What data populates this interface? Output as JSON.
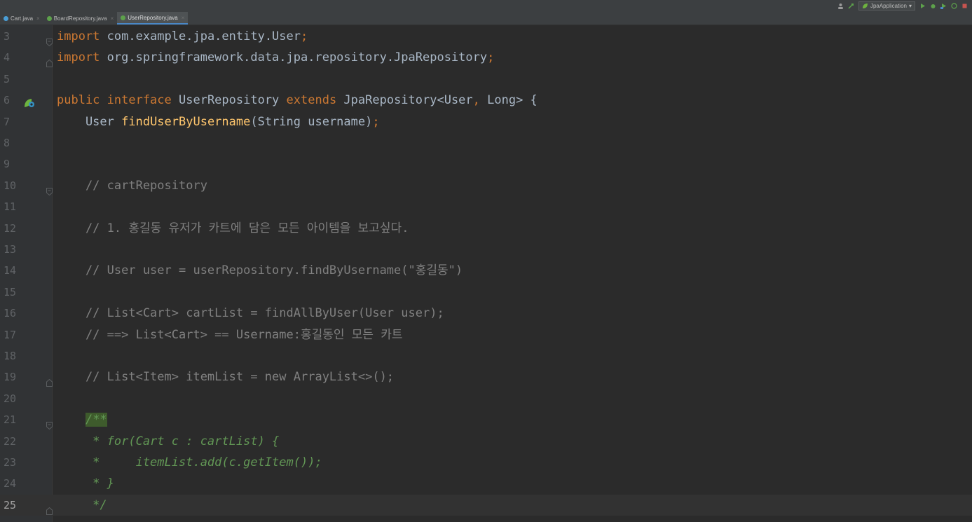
{
  "tabs": [
    {
      "label": "Cart.java",
      "icon_color": "#4a9ed6",
      "active": false
    },
    {
      "label": "BoardRepository.java",
      "icon_color": "#5da14b",
      "active": false
    },
    {
      "label": "UserRepository.java",
      "icon_color": "#5da14b",
      "active": true
    }
  ],
  "run_config": {
    "label": "JpaApplication"
  },
  "colors": {
    "keyword": "#cc7832",
    "method": "#ffc66d",
    "comment": "#808080",
    "doc_comment": "#629755",
    "text": "#a9b7c6",
    "background": "#2b2b2b"
  },
  "lines": [
    {
      "num": "3",
      "segments": [
        {
          "cls": "kw",
          "text": "import"
        },
        {
          "cls": "plain",
          "text": " com.example.jpa.entity.User"
        },
        {
          "cls": "kw",
          "text": ";"
        }
      ]
    },
    {
      "num": "4",
      "segments": [
        {
          "cls": "kw",
          "text": "import"
        },
        {
          "cls": "plain",
          "text": " org.springframework.data.jpa.repository.JpaRepository"
        },
        {
          "cls": "kw",
          "text": ";"
        }
      ]
    },
    {
      "num": "5",
      "segments": []
    },
    {
      "num": "6",
      "segments": [
        {
          "cls": "kw",
          "text": "public interface"
        },
        {
          "cls": "plain",
          "text": " UserRepository "
        },
        {
          "cls": "kw",
          "text": "extends"
        },
        {
          "cls": "plain",
          "text": " JpaRepository<User"
        },
        {
          "cls": "kw",
          "text": ","
        },
        {
          "cls": "plain",
          "text": " Long> {"
        }
      ]
    },
    {
      "num": "7",
      "segments": [
        {
          "cls": "plain",
          "text": "    User "
        },
        {
          "cls": "fn",
          "text": "findUserByUsername"
        },
        {
          "cls": "plain",
          "text": "(String username)"
        },
        {
          "cls": "kw",
          "text": ";"
        }
      ]
    },
    {
      "num": "8",
      "segments": []
    },
    {
      "num": "9",
      "segments": []
    },
    {
      "num": "10",
      "segments": [
        {
          "cls": "cm",
          "text": "    // cartRepository"
        }
      ]
    },
    {
      "num": "11",
      "segments": []
    },
    {
      "num": "12",
      "segments": [
        {
          "cls": "cm",
          "text": "    // 1. 홍길동 유저가 카트에 담은 모든 아이템을 보고싶다."
        }
      ]
    },
    {
      "num": "13",
      "segments": []
    },
    {
      "num": "14",
      "segments": [
        {
          "cls": "cm",
          "text": "    // User user = userRepository.findByUsername(\"홍길동\")"
        }
      ]
    },
    {
      "num": "15",
      "segments": []
    },
    {
      "num": "16",
      "segments": [
        {
          "cls": "cm",
          "text": "    // List<Cart> cartList = findAllByUser(User user);"
        }
      ]
    },
    {
      "num": "17",
      "segments": [
        {
          "cls": "cm",
          "text": "    // ==> List<Cart> == Username:홍길동인 모든 카트"
        }
      ]
    },
    {
      "num": "18",
      "segments": []
    },
    {
      "num": "19",
      "segments": [
        {
          "cls": "cm",
          "text": "    // List<Item> itemList = new ArrayList<>();"
        }
      ]
    },
    {
      "num": "20",
      "segments": []
    },
    {
      "num": "21",
      "segments": [
        {
          "cls": "plain",
          "text": "    "
        },
        {
          "cls": "doc hl",
          "text": "/**"
        }
      ]
    },
    {
      "num": "22",
      "segments": [
        {
          "cls": "doc",
          "text": "     * for(Cart c : cartList) {"
        }
      ]
    },
    {
      "num": "23",
      "segments": [
        {
          "cls": "doc",
          "text": "     *     itemList.add(c.getItem());"
        }
      ]
    },
    {
      "num": "24",
      "segments": [
        {
          "cls": "doc",
          "text": "     * }"
        }
      ]
    },
    {
      "num": "25",
      "segments": [
        {
          "cls": "doc",
          "text": "     */"
        }
      ]
    }
  ]
}
